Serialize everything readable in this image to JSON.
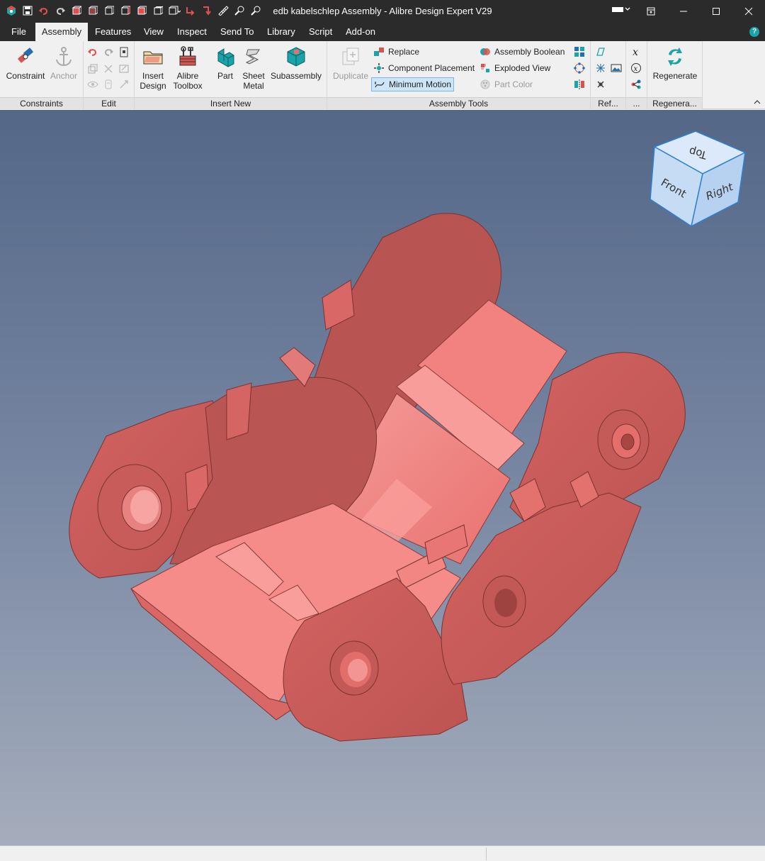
{
  "window": {
    "title": "edb kabelschlep Assembly - Alibre Design Expert V29",
    "controls": [
      "minimize-icon",
      "maximize-icon",
      "close-icon"
    ]
  },
  "menu": {
    "tabs": [
      {
        "label": "File"
      },
      {
        "label": "Assembly"
      },
      {
        "label": "Features"
      },
      {
        "label": "View"
      },
      {
        "label": "Inspect"
      },
      {
        "label": "Send To"
      },
      {
        "label": "Library"
      },
      {
        "label": "Script"
      },
      {
        "label": "Add-on"
      }
    ],
    "active_tab": "Assembly"
  },
  "ribbon": {
    "constraints": {
      "label": "Constraints",
      "constraint": "Constraint",
      "anchor": "Anchor"
    },
    "edit": {
      "label": "Edit"
    },
    "insert_new": {
      "label": "Insert New",
      "insert_design_1": "Insert",
      "insert_design_2": "Design",
      "toolbox_1": "Alibre",
      "toolbox_2": "Toolbox",
      "part": "Part",
      "sheet_metal_1": "Sheet",
      "sheet_metal_2": "Metal",
      "subassembly": "Subassembly"
    },
    "assembly_tools": {
      "label": "Assembly Tools",
      "duplicate": "Duplicate",
      "replace": "Replace",
      "component_placement": "Component Placement",
      "minimum_motion": "Minimum Motion",
      "assembly_boolean": "Assembly Boolean",
      "exploded_view": "Exploded View",
      "part_color": "Part Color"
    },
    "reference": {
      "label": "Ref..."
    },
    "equations": {
      "label": "..."
    },
    "regenerate": {
      "label": "Regenera...",
      "button": "Regenerate"
    }
  },
  "viewcube": {
    "top": "Top",
    "front": "Front",
    "right": "Right"
  },
  "colors": {
    "titlebar": "#2b2b2b",
    "ribbon": "#f0f0f0",
    "accent": "#1aa3a8",
    "part": "#e8716f",
    "viewport_top": "#546787",
    "viewport_bottom": "#a5adbc"
  }
}
